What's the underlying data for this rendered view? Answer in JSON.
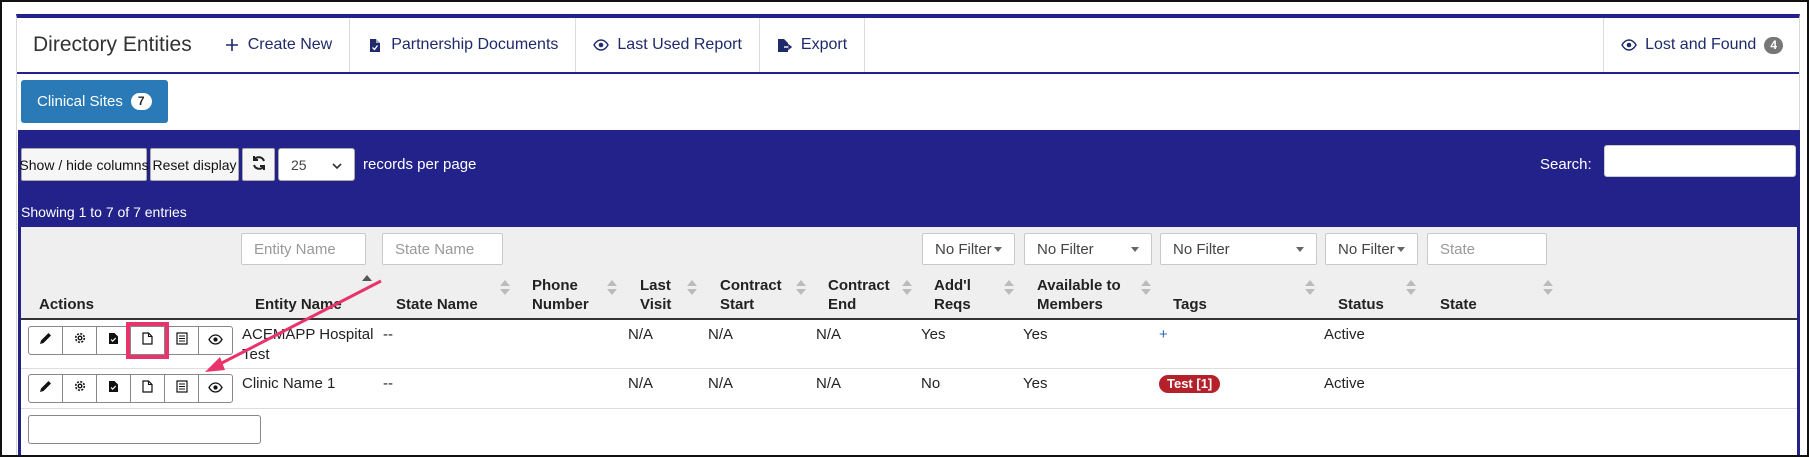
{
  "nav": {
    "title": "Directory Entities",
    "links": [
      {
        "label": "Create New",
        "icon": "plus-icon"
      },
      {
        "label": "Partnership Documents",
        "icon": "file-icon"
      },
      {
        "label": "Last Used Report",
        "icon": "eye-icon"
      },
      {
        "label": "Export",
        "icon": "export-file-icon"
      }
    ],
    "lost_found": {
      "label": "Lost and Found",
      "count": "4",
      "icon": "eye-icon"
    }
  },
  "tab": {
    "label": "Clinical Sites",
    "count": "7"
  },
  "controls": {
    "show_hide": "Show / hide columns",
    "reset": "Reset display",
    "per_page": "25",
    "per_page_suffix": "records per page",
    "search_label": "Search:",
    "showing": "Showing 1 to 7 of 7 entries"
  },
  "filters": {
    "entity_name_placeholder": "Entity Name",
    "state_name_placeholder": "State Name",
    "addl_reqs": "No Filter",
    "available": "No Filter",
    "tags": "No Filter",
    "status": "No Filter",
    "state_placeholder": "State"
  },
  "columns": {
    "actions": "Actions",
    "entity_name": "Entity Name",
    "state_name": "State Name",
    "phone_l1": "Phone",
    "phone_l2": "Number",
    "last_l1": "Last",
    "last_l2": "Visit",
    "cstart_l1": "Contract",
    "cstart_l2": "Start",
    "cend_l1": "Contract",
    "cend_l2": "End",
    "addl_l1": "Add'l",
    "addl_l2": "Reqs",
    "avail_l1": "Available to",
    "avail_l2": "Members",
    "tags": "Tags",
    "status": "Status",
    "state": "State"
  },
  "rows": [
    {
      "entity_l1": "ACEMAPP Hospital",
      "entity_l2": "Test",
      "state_name": "--",
      "phone": "",
      "last_visit": "N/A",
      "contract_start": "N/A",
      "contract_end": "N/A",
      "addl_reqs": "Yes",
      "available": "Yes",
      "tag": "+",
      "status": "Active",
      "state": ""
    },
    {
      "entity_l1": "Clinic Name 1",
      "entity_l2": "",
      "state_name": "--",
      "phone": "",
      "last_visit": "N/A",
      "contract_start": "N/A",
      "contract_end": "N/A",
      "addl_reqs": "No",
      "available": "Yes",
      "tag": "Test [1]",
      "status": "Active",
      "state": ""
    }
  ],
  "colors": {
    "navy": "#22228a",
    "tab_blue": "#2a7ab8",
    "highlight": "#e8336b",
    "tag_red": "#b5212a"
  }
}
